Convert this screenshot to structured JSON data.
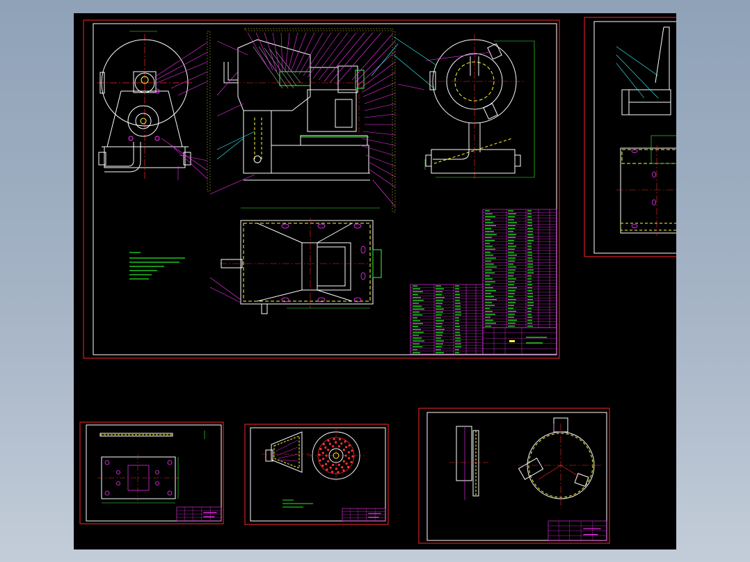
{
  "window": {
    "background": "#98a8bc",
    "canvas_background": "#000000"
  },
  "palette": {
    "frame": "#d42020",
    "border": "#ffffff",
    "geometry": "#ffffff",
    "centerline": "#ff2a2a",
    "hidden": "#ffff33",
    "leader": "#ff33ff",
    "dimension": "#33ff33",
    "cyan": "#33ffff",
    "table_text": "#22ee22"
  },
  "sheets": [
    {
      "id": "main-assembly",
      "views": [
        "front-view",
        "section-view",
        "side-view",
        "top-view",
        "parts-list",
        "technical-notes"
      ]
    },
    {
      "id": "partial-right",
      "views": [
        "frame-detail"
      ]
    },
    {
      "id": "plate-detail",
      "views": [
        "plate-top",
        "plate-edge"
      ]
    },
    {
      "id": "disc-detail",
      "views": [
        "cone-section",
        "perforated-disc"
      ]
    },
    {
      "id": "housing-detail",
      "views": [
        "housing-side",
        "housing-round"
      ]
    }
  ],
  "icons": {
    "callout": "balloon-leader-icon",
    "center_mark": "crosshair-icon"
  }
}
